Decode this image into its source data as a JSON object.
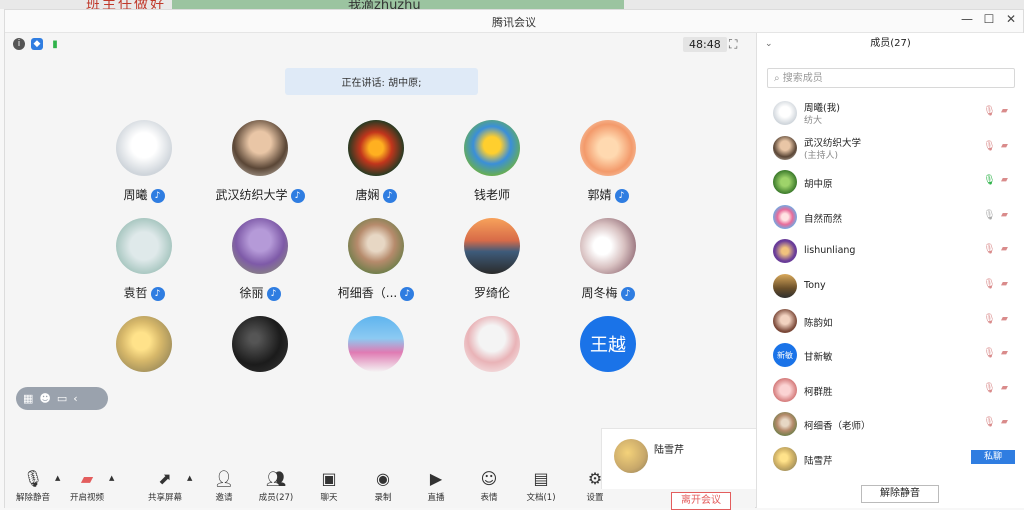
{
  "background": {
    "text_left": "班主任做好",
    "text_mid": "我滴zhuzhu"
  },
  "window": {
    "title": "腾讯会议",
    "controls": [
      "—",
      "☐",
      "✕"
    ]
  },
  "header": {
    "timer": "48:48"
  },
  "speaking": {
    "label": "正在讲话: 胡中原;"
  },
  "participants": [
    {
      "name": "周曦",
      "mic": true
    },
    {
      "name": "武汉纺织大学",
      "mic": true
    },
    {
      "name": "唐娴",
      "mic": true
    },
    {
      "name": "钱老师",
      "mic": false
    },
    {
      "name": "郭婧",
      "mic": true
    },
    {
      "name": "袁哲",
      "mic": true
    },
    {
      "name": "徐丽",
      "mic": true
    },
    {
      "name": "柯细香（...",
      "mic": true
    },
    {
      "name": "罗绮伦",
      "mic": false
    },
    {
      "name": "周冬梅",
      "mic": true
    },
    {
      "name": "",
      "mic": false
    },
    {
      "name": "",
      "mic": false
    },
    {
      "name": "",
      "mic": false
    },
    {
      "name": "",
      "mic": false
    },
    {
      "name": "",
      "mic": false,
      "initials": "王越"
    }
  ],
  "local_video": {
    "name": "陆雪芹"
  },
  "toolbar": {
    "unmute": "解除静音",
    "start_video": "开启视频",
    "share": "共享屏幕",
    "invite": "邀请",
    "members": "成员(27)",
    "chat": "聊天",
    "record": "录制",
    "live": "直播",
    "reactions": "表情",
    "docs": "文档(1)",
    "settings": "设置",
    "leave": "离开会议"
  },
  "panel": {
    "title": "成员(27)",
    "search_placeholder": "搜索成员",
    "members": [
      {
        "name": "周曦(我)",
        "sub": "纺大",
        "initials": ""
      },
      {
        "name": "武汉纺织大学",
        "sub": "(主持人)",
        "initials": ""
      },
      {
        "name": "胡中原",
        "sub": "",
        "initials": ""
      },
      {
        "name": "自然而然",
        "sub": "",
        "initials": ""
      },
      {
        "name": "lishunliang",
        "sub": "",
        "initials": ""
      },
      {
        "name": "Tony",
        "sub": "",
        "initials": ""
      },
      {
        "name": "陈韵如",
        "sub": "",
        "initials": ""
      },
      {
        "name": "甘新敏",
        "sub": "",
        "initials": "新敏"
      },
      {
        "name": "柯群胜",
        "sub": "",
        "initials": ""
      },
      {
        "name": "柯细香（老师）",
        "sub": "",
        "initials": ""
      },
      {
        "name": "陆雪芹",
        "sub": "",
        "initials": ""
      }
    ],
    "private_chat": "私聊",
    "unmute_all": "解除静音"
  },
  "colors": {
    "accent": "#2f7de1",
    "danger": "#e35d5d"
  }
}
